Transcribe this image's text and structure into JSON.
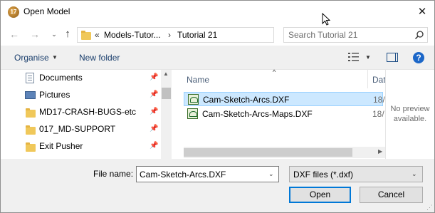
{
  "window": {
    "title": "Open Model",
    "app_icon_text": "17"
  },
  "address": {
    "overflow": "«",
    "crumbs": [
      "Models-Tutor...",
      "Tutorial 21"
    ],
    "separator": "›"
  },
  "search": {
    "placeholder": "Search Tutorial 21"
  },
  "toolbar": {
    "organise": "Organise",
    "new_folder": "New folder",
    "help": "?"
  },
  "nav_pane": {
    "items": [
      {
        "label": "Documents",
        "icon": "document-icon",
        "pinned": true
      },
      {
        "label": "Pictures",
        "icon": "pictures-icon",
        "pinned": true
      },
      {
        "label": "MD17-CRASH-BUGS-etc",
        "icon": "folder-icon",
        "pinned": true
      },
      {
        "label": "017_MD-SUPPORT",
        "icon": "folder-icon",
        "pinned": true
      },
      {
        "label": "Exit Pusher",
        "icon": "folder-icon",
        "pinned": true
      }
    ]
  },
  "file_list": {
    "columns": {
      "name": "Name",
      "date": "Dat"
    },
    "files": [
      {
        "name": "Cam-Sketch-Arcs.DXF",
        "date": "18/",
        "selected": true
      },
      {
        "name": "Cam-Sketch-Arcs-Maps.DXF",
        "date": "18/",
        "selected": false
      }
    ]
  },
  "preview": {
    "line1": "No preview",
    "line2": "available."
  },
  "footer": {
    "file_name_label": "File name:",
    "file_name_value": "Cam-Sketch-Arcs.DXF",
    "filter": "DXF files (*.dxf)",
    "open": "Open",
    "cancel": "Cancel"
  },
  "colors": {
    "selection": "#cce8ff",
    "accent": "#0078d7",
    "link": "#1a3e6c"
  }
}
